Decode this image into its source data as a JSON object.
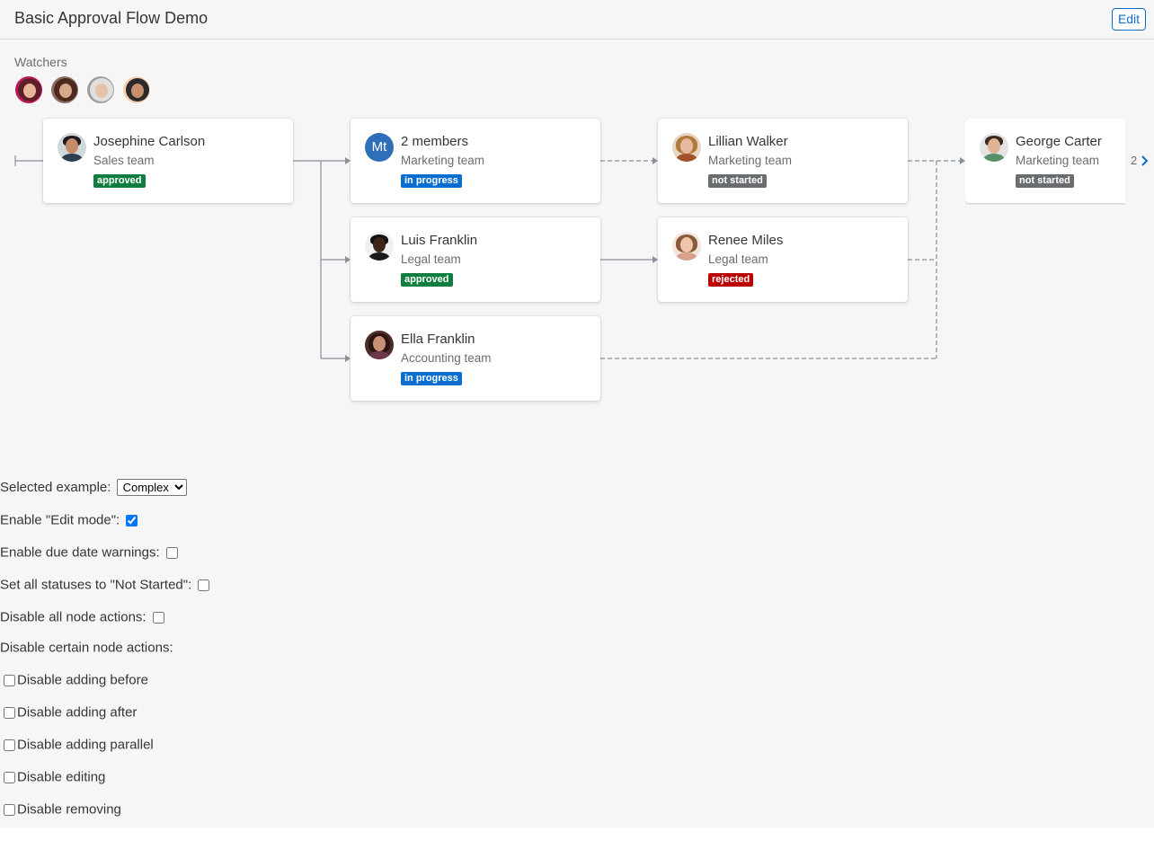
{
  "header": {
    "title": "Basic Approval Flow Demo",
    "edit_label": "Edit"
  },
  "watchers": {
    "label": "Watchers",
    "avatars": [
      {
        "name": "avatar-watcher-1",
        "bg": "#c2185b",
        "hair": "#5d1f2a",
        "face": "#e8b59a"
      },
      {
        "name": "avatar-watcher-2",
        "bg": "#8d6e63",
        "hair": "#4e2a1e",
        "face": "#d7a98a"
      },
      {
        "name": "avatar-watcher-3",
        "bg": "#9e9e9e",
        "hair": "#e0e0e0",
        "face": "#e6c3a8"
      },
      {
        "name": "avatar-watcher-4",
        "bg": "#f5cfb5",
        "hair": "#2b2b2b",
        "face": "#c98f6d"
      }
    ]
  },
  "nodes": [
    {
      "name": "Josephine Carlson",
      "team": "Sales team",
      "status": "approved"
    },
    {
      "name": "2 members",
      "team": "Marketing team",
      "status": "in progress",
      "initials": "Mt"
    },
    {
      "name": "Lillian Walker",
      "team": "Marketing team",
      "status": "not started"
    },
    {
      "name": "George Carter",
      "team": "Marketing team",
      "status": "not started"
    },
    {
      "name": "Luis Franklin",
      "team": "Legal team",
      "status": "approved"
    },
    {
      "name": "Renee Miles",
      "team": "Legal team",
      "status": "rejected"
    },
    {
      "name": "Ella Franklin",
      "team": "Accounting team",
      "status": "in progress"
    }
  ],
  "pager": {
    "page": "2"
  },
  "colors": {
    "approved": "#107e3e",
    "in_progress": "#0a6ed1",
    "not_started": "#6a6d70",
    "rejected": "#bb0000",
    "accent": "#0a6ed1"
  },
  "form": {
    "selected_example_label": "Selected example:",
    "selected_example_value": "Complex",
    "edit_mode_label": "Enable \"Edit mode\":",
    "edit_mode_checked": true,
    "due_date_label": "Enable due date warnings:",
    "due_date_checked": false,
    "not_started_label": "Set all statuses to \"Not Started\":",
    "not_started_checked": false,
    "disable_all_label": "Disable all node actions:",
    "disable_all_checked": false,
    "disable_certain_label": "Disable certain node actions:",
    "options": [
      {
        "label": "Disable adding before",
        "checked": false
      },
      {
        "label": "Disable adding after",
        "checked": false
      },
      {
        "label": "Disable adding parallel",
        "checked": false
      },
      {
        "label": "Disable editing",
        "checked": false
      },
      {
        "label": "Disable removing",
        "checked": false
      }
    ]
  }
}
